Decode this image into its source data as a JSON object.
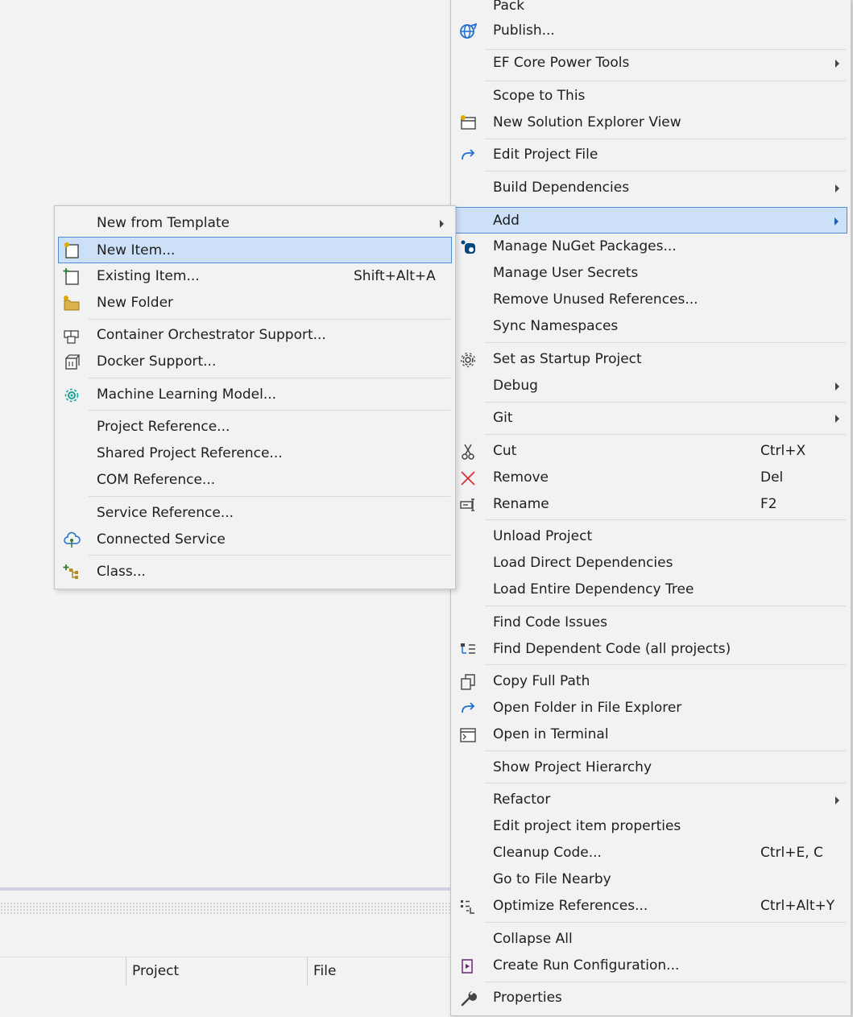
{
  "background": {
    "columns": [
      "Project",
      "File"
    ]
  },
  "main_menu": {
    "items": [
      {
        "label": "Pack",
        "icon": ""
      },
      {
        "label": "Publish...",
        "icon": "globe-icon"
      },
      {
        "label": "EF Core Power Tools",
        "submenu": true
      },
      {
        "label": "Scope to This"
      },
      {
        "label": "New Solution Explorer View",
        "icon": "new-window-icon"
      },
      {
        "label": "Edit Project File",
        "icon": "redo-arrow-icon"
      },
      {
        "label": "Build Dependencies",
        "submenu": true
      },
      {
        "label": "Add",
        "submenu": true,
        "highlighted": true
      },
      {
        "label": "Manage NuGet Packages...",
        "icon": "nuget-icon"
      },
      {
        "label": "Manage User Secrets"
      },
      {
        "label": "Remove Unused References..."
      },
      {
        "label": "Sync Namespaces"
      },
      {
        "label": "Set as Startup Project",
        "icon": "gear-icon"
      },
      {
        "label": "Debug",
        "submenu": true
      },
      {
        "label": "Git",
        "submenu": true
      },
      {
        "label": "Cut",
        "shortcut": "Ctrl+X",
        "icon": "scissors-icon"
      },
      {
        "label": "Remove",
        "shortcut": "Del",
        "icon": "remove-x-icon"
      },
      {
        "label": "Rename",
        "shortcut": "F2",
        "icon": "rename-icon"
      },
      {
        "label": "Unload Project"
      },
      {
        "label": "Load Direct Dependencies"
      },
      {
        "label": "Load Entire Dependency Tree"
      },
      {
        "label": "Find Code Issues"
      },
      {
        "label": "Find Dependent Code (all projects)",
        "icon": "dependency-icon"
      },
      {
        "label": "Copy Full Path",
        "icon": "copy-icon"
      },
      {
        "label": "Open Folder in File Explorer",
        "icon": "redo-arrow-icon"
      },
      {
        "label": "Open in Terminal",
        "icon": "terminal-icon"
      },
      {
        "label": "Show Project Hierarchy"
      },
      {
        "label": "Refactor",
        "submenu": true
      },
      {
        "label": "Edit project item properties"
      },
      {
        "label": "Cleanup Code...",
        "shortcut": "Ctrl+E, C"
      },
      {
        "label": "Go to File Nearby"
      },
      {
        "label": "Optimize References...",
        "shortcut": "Ctrl+Alt+Y",
        "icon": "optimize-icon"
      },
      {
        "label": "Collapse All"
      },
      {
        "label": "Create Run Configuration...",
        "icon": "run-config-icon"
      },
      {
        "label": "Properties",
        "icon": "wrench-icon"
      }
    ]
  },
  "add_submenu": {
    "items": [
      {
        "label": "New from Template",
        "submenu": true
      },
      {
        "label": "New Item...",
        "highlighted": true,
        "icon": "new-item-icon"
      },
      {
        "label": "Existing Item...",
        "shortcut": "Shift+Alt+A",
        "icon": "existing-item-icon"
      },
      {
        "label": "New Folder",
        "icon": "new-folder-icon"
      },
      {
        "label": "Container Orchestrator Support...",
        "icon": "container-icon"
      },
      {
        "label": "Docker Support...",
        "icon": "docker-icon"
      },
      {
        "label": "Machine Learning Model...",
        "icon": "ml-model-icon"
      },
      {
        "label": "Project Reference..."
      },
      {
        "label": "Shared Project Reference..."
      },
      {
        "label": "COM Reference..."
      },
      {
        "label": "Service Reference..."
      },
      {
        "label": "Connected Service",
        "icon": "connected-service-icon"
      },
      {
        "label": "Class...",
        "icon": "class-icon"
      }
    ]
  }
}
